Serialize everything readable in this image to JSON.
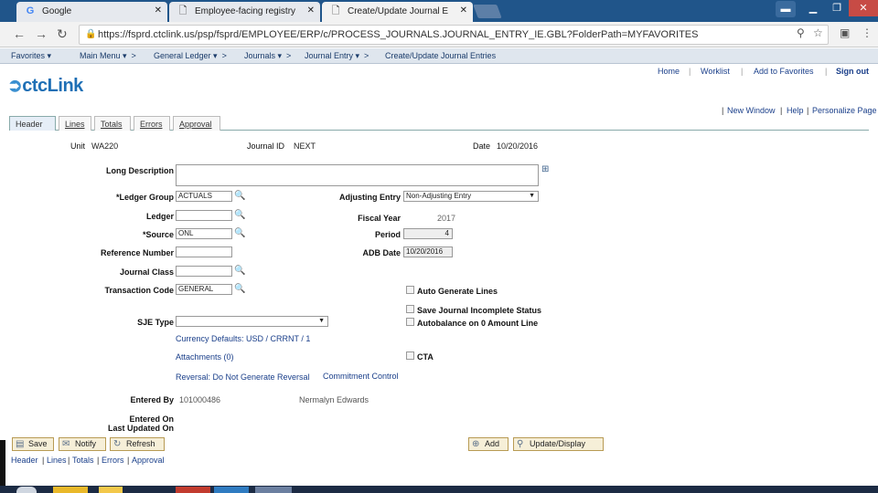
{
  "browser": {
    "tabs": [
      {
        "title": "Google",
        "icon": "google-favicon"
      },
      {
        "title": "Employee-facing registry",
        "icon": "page-icon"
      },
      {
        "title": "Create/Update Journal E",
        "icon": "page-icon"
      }
    ],
    "url": "https://fsprd.ctclink.us/psp/fsprd/EMPLOYEE/ERP/c/PROCESS_JOURNALS.JOURNAL_ENTRY_IE.GBL?FolderPath=MYFAVORITES"
  },
  "menubar": {
    "favorites": "Favorites",
    "main_menu": "Main Menu",
    "general_ledger": "General Ledger",
    "journals": "Journals",
    "journal_entry": "Journal Entry",
    "current": "Create/Update Journal Entries"
  },
  "header_links": {
    "home": "Home",
    "worklist": "Worklist",
    "add_favorites": "Add to Favorites",
    "sign_out": "Sign out"
  },
  "logo_text": "ctcLink",
  "page_links": {
    "new_window": "New Window",
    "help": "Help",
    "personalize": "Personalize Page"
  },
  "page_tabs": [
    "Header",
    "Lines",
    "Totals",
    "Errors",
    "Approval"
  ],
  "form": {
    "unit_label": "Unit",
    "unit": "WA220",
    "journal_id_label": "Journal ID",
    "journal_id": "NEXT",
    "date_label": "Date",
    "date": "10/20/2016",
    "long_desc_label": "Long Description",
    "ledger_group_label": "*Ledger Group",
    "ledger_group": "ACTUALS",
    "adjusting_entry_label": "Adjusting Entry",
    "adjusting_entry": "Non-Adjusting Entry",
    "ledger_label": "Ledger",
    "fiscal_year_label": "Fiscal Year",
    "fiscal_year": "2017",
    "source_label": "*Source",
    "source": "ONL",
    "period_label": "Period",
    "period": "4",
    "reference_label": "Reference Number",
    "adb_date_label": "ADB Date",
    "adb_date": "10/20/2016",
    "journal_class_label": "Journal Class",
    "transaction_code_label": "Transaction Code",
    "transaction_code": "GENERAL",
    "auto_generate_label": "Auto Generate Lines",
    "save_incomplete_label": "Save Journal Incomplete Status",
    "sje_type_label": "SJE Type",
    "autobalance_label": "Autobalance on 0 Amount Line",
    "currency_defaults": "Currency Defaults: USD / CRRNT / 1",
    "attachments": "Attachments (0)",
    "cta_label": "CTA",
    "reversal": "Reversal: Do Not Generate Reversal",
    "commitment_control": "Commitment Control",
    "entered_by_label": "Entered By",
    "entered_by_id": "101000486",
    "entered_by_name": "Nermalyn Edwards",
    "entered_on_label": "Entered On",
    "last_updated_label": "Last Updated On"
  },
  "toolbar": {
    "save": "Save",
    "notify": "Notify",
    "refresh": "Refresh",
    "add": "Add",
    "update_display": "Update/Display"
  },
  "bottom_links": [
    "Header",
    "Lines",
    "Totals",
    "Errors",
    "Approval"
  ],
  "colors": {
    "brand": "#1e6fb5",
    "link": "#1a3f8a",
    "tabbar": "#20558a"
  }
}
